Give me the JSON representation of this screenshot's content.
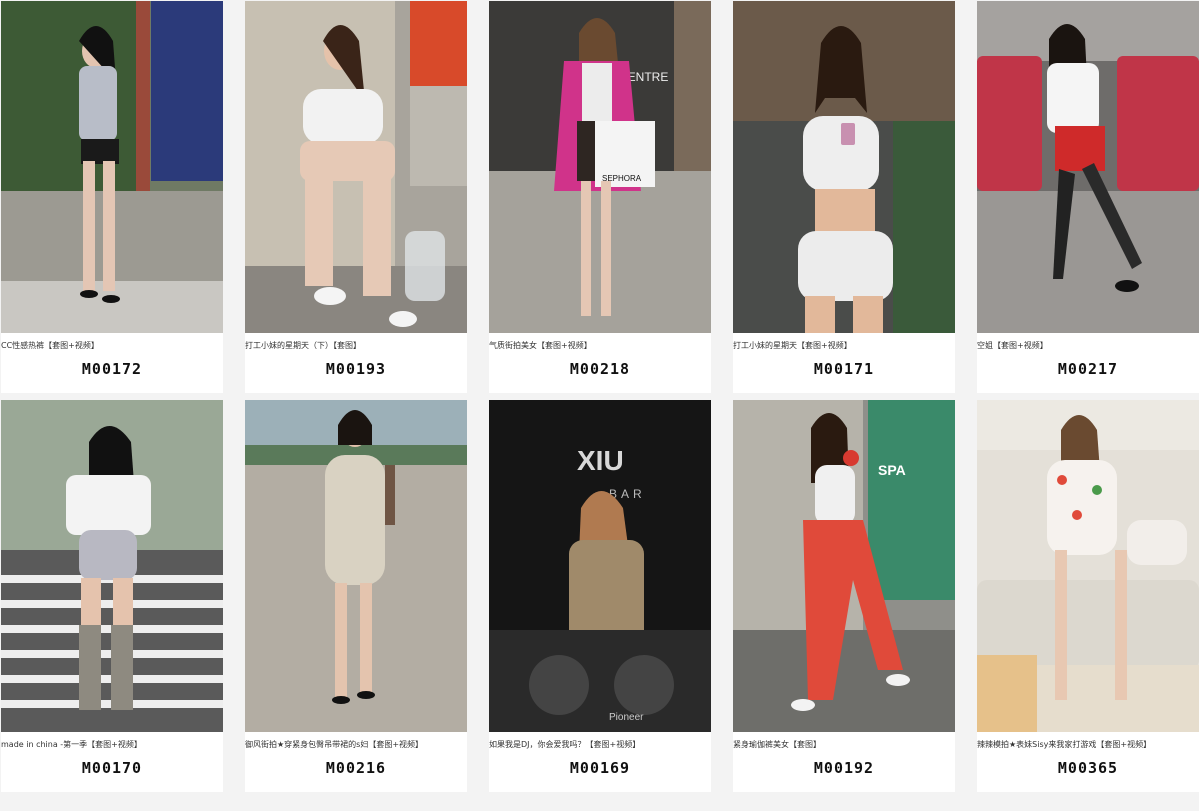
{
  "gallery": {
    "items": [
      {
        "caption": "CC性感热裤【套图+视频】",
        "code": "M00172"
      },
      {
        "caption": "打工小妹的星期天（下）【套图】",
        "code": "M00193"
      },
      {
        "caption": "气质街拍美女【套图+视频】",
        "code": "M00218"
      },
      {
        "caption": "打工小妹的星期天【套图+视频】",
        "code": "M00171"
      },
      {
        "caption": "空姐【套图+视频】",
        "code": "M00217"
      },
      {
        "caption": "made in china -第一季【套图+视频】",
        "code": "M00170"
      },
      {
        "caption": "御风街拍★穿紧身包臀吊带裙的s妇【套图+视频】",
        "code": "M00216"
      },
      {
        "caption": "如果我是DJ，你会爱我吗？【套图+视频】",
        "code": "M00169"
      },
      {
        "caption": "紧身瑜伽裤美女【套图】",
        "code": "M00192"
      },
      {
        "caption": "辣辣模拍★表妹Sisy来我家打游戏【套图+视频】",
        "code": "M00365"
      }
    ]
  },
  "signage": {
    "shopping_bag": "SEPHORA",
    "wall_text": "CENTRE",
    "club_sign": "XIU",
    "club_sub": "BAR",
    "mall_sign": "SPA",
    "pioneer": "Pioneer"
  }
}
